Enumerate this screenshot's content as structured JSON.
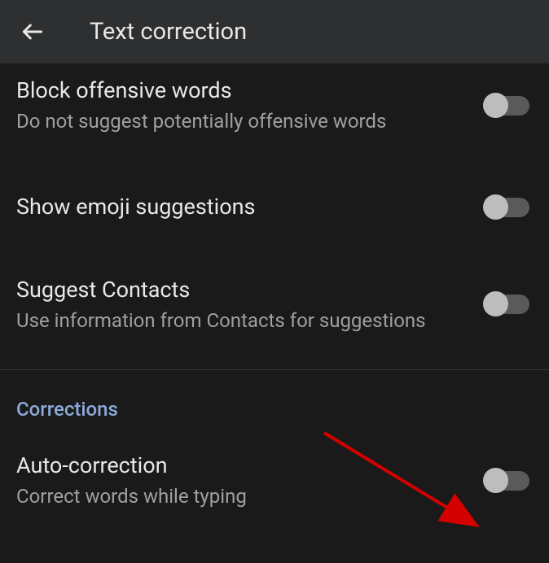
{
  "header": {
    "title": "Text correction"
  },
  "settings": [
    {
      "title": "Block offensive words",
      "subtitle": "Do not suggest potentially offensive words",
      "enabled": false
    },
    {
      "title": "Show emoji suggestions",
      "subtitle": "",
      "enabled": false
    },
    {
      "title": "Suggest Contacts",
      "subtitle": "Use information from Contacts for suggestions",
      "enabled": false
    }
  ],
  "section": {
    "header": "Corrections"
  },
  "corrections_settings": [
    {
      "title": "Auto-correction",
      "subtitle": "Correct words while typing",
      "enabled": false
    }
  ]
}
